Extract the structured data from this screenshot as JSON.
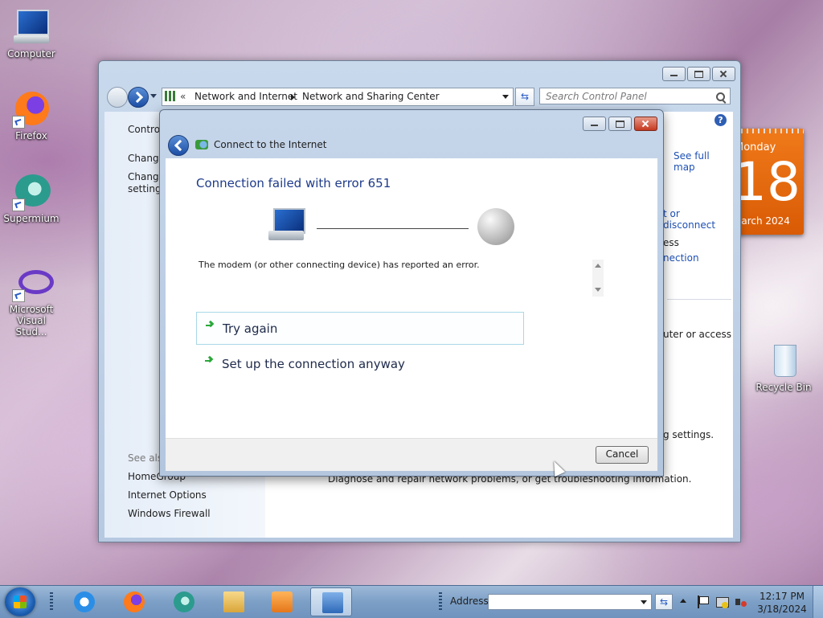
{
  "desktop": {
    "icons": [
      {
        "label": "Computer"
      },
      {
        "label": "Firefox"
      },
      {
        "label": "Supermium"
      },
      {
        "label": "Microsoft Visual Stud..."
      },
      {
        "label": "Recycle Bin"
      }
    ],
    "calendar": {
      "day": "Monday",
      "date": "18",
      "month": "March 2024"
    }
  },
  "control_panel": {
    "breadcrumb_chevron": "«",
    "breadcrumb": [
      "Network and Internet",
      "Network and Sharing Center"
    ],
    "search_placeholder": "Search Control Panel",
    "help": "?",
    "sidebar": {
      "items": [
        "Control",
        "Change",
        "Change",
        "settings"
      ],
      "see_also_label": "See also",
      "see_also": [
        "HomeGroup",
        "Internet Options",
        "Windows Firewall"
      ]
    },
    "main": {
      "see_full_map": "See full map",
      "connect_or_disconnect": "t or disconnect",
      "access_text": "ess",
      "connection_link": "nection",
      "router_text": "uter or access",
      "settings_text": "g settings.",
      "troubleshoot_text": "Diagnose and repair network problems, or get troubleshooting information."
    }
  },
  "dialog": {
    "title": "Connect to the Internet",
    "heading": "Connection failed with error 651",
    "message": "The modem (or other connecting device) has reported an error.",
    "options": [
      "Try again",
      "Set up the connection anyway"
    ],
    "cancel": "Cancel"
  },
  "taskbar": {
    "address_label": "Address",
    "address_value": "",
    "time": "12:17 PM",
    "date": "3/18/2024"
  },
  "colors": {
    "accent": "#1e3b8a",
    "link": "#1e50b4",
    "option_arrow": "#2aa83a",
    "calendar": "#e56a0f"
  }
}
